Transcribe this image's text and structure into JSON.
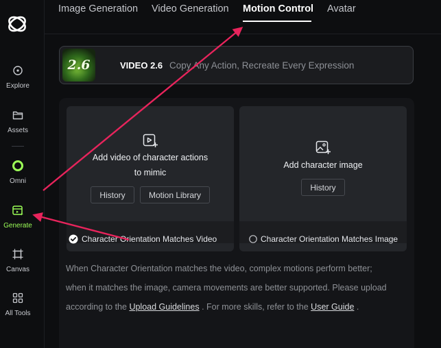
{
  "sidebar": {
    "items": [
      {
        "label": "Explore",
        "icon": "explore-icon"
      },
      {
        "label": "Assets",
        "icon": "folder-icon"
      },
      {
        "label": "Omni",
        "icon": "omni-icon"
      },
      {
        "label": "Generate",
        "icon": "generate-icon",
        "active": true
      },
      {
        "label": "Canvas",
        "icon": "canvas-icon"
      },
      {
        "label": "All Tools",
        "icon": "grid-icon"
      }
    ]
  },
  "tabs": [
    {
      "label": "Image Generation"
    },
    {
      "label": "Video Generation"
    },
    {
      "label": "Motion Control",
      "active": true
    },
    {
      "label": "Avatar"
    }
  ],
  "banner": {
    "badge": "2.6",
    "title": "VIDEO 2.6",
    "subtitle": "Copy Any Action, Recreate Every Expression"
  },
  "video_card": {
    "caption_line1": "Add video of character actions",
    "caption_line2": "to mimic",
    "history_label": "History",
    "library_label": "Motion Library",
    "orientation_label": "Character Orientation Matches Video",
    "orientation_selected": true
  },
  "image_card": {
    "caption": "Add character image",
    "history_label": "History",
    "orientation_label": "Character Orientation Matches Image",
    "orientation_selected": false
  },
  "description": {
    "line1": "When Character Orientation matches the video, complex motions perform better;",
    "line2": "when it matches the image, camera movements are better supported. Please upload",
    "line3_prefix": "according to the",
    "guidelines_link": "Upload Guidelines",
    "line3_middle": ". For more skills, refer to the",
    "guide_link": "User Guide",
    "line3_suffix": "."
  },
  "colors": {
    "accent_green": "#9cff57",
    "annotation_arrow": "#e8245c",
    "background": "#0d0e10"
  }
}
